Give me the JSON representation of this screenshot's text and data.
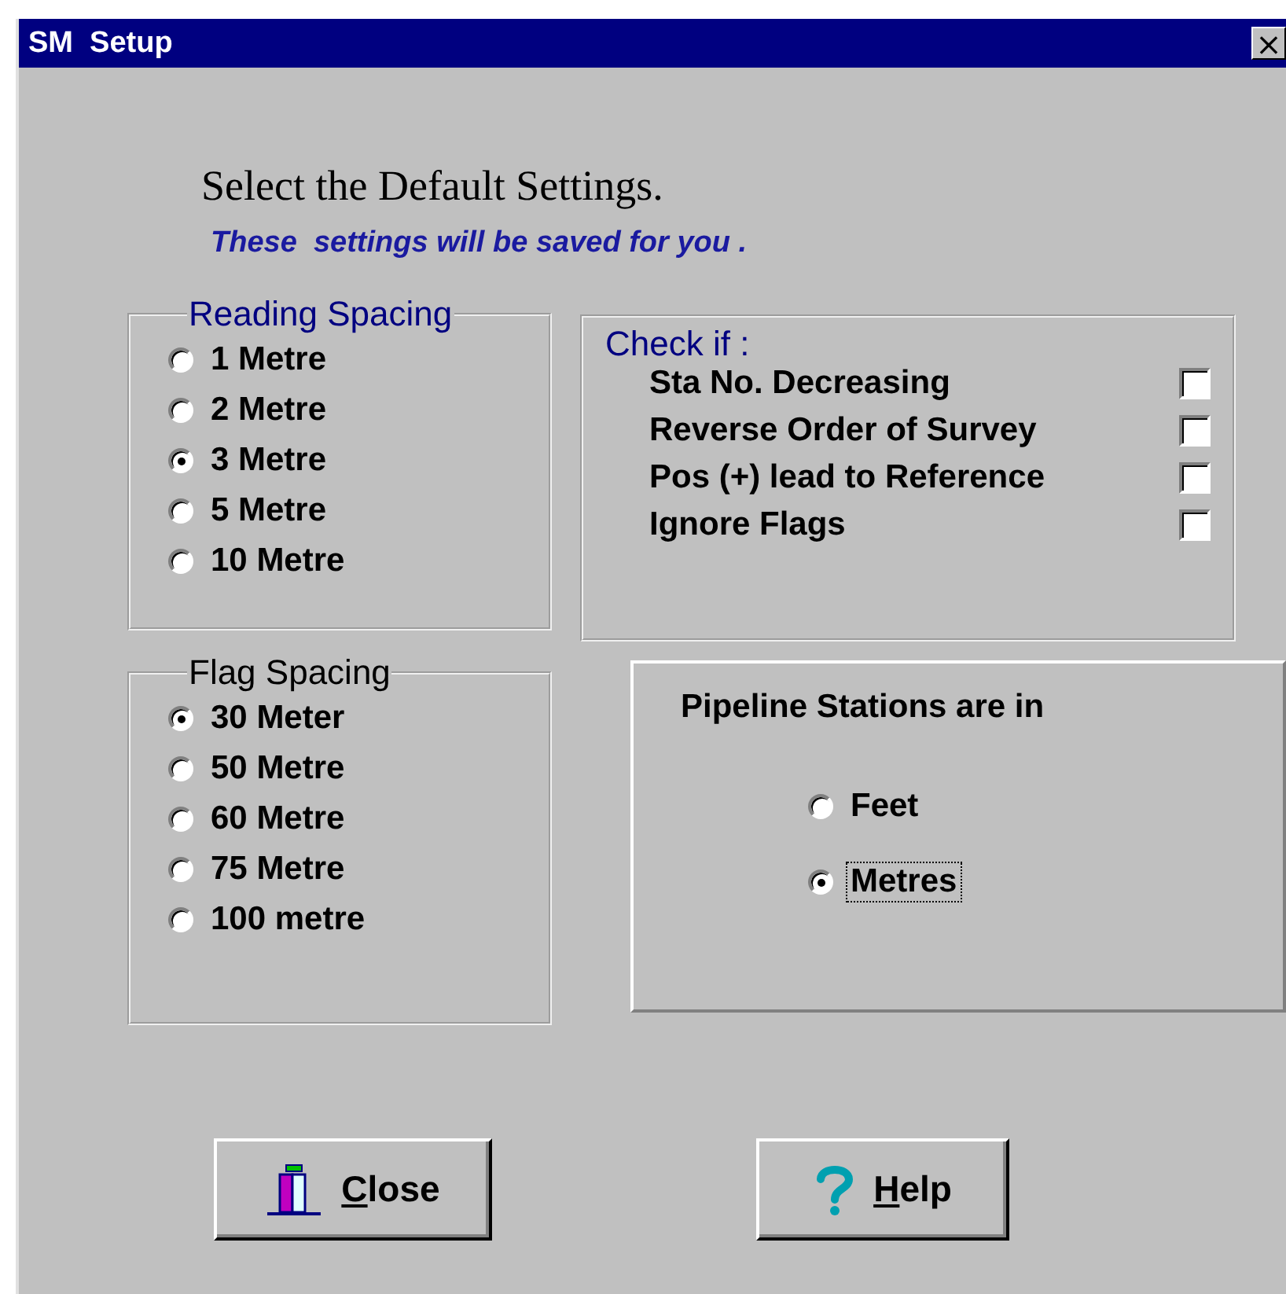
{
  "window": {
    "title": "SM  Setup",
    "close_glyph": "×"
  },
  "heading": "Select the Default Settings.",
  "subheading": "These  settings will be saved for you .",
  "reading_spacing": {
    "title": "Reading Spacing",
    "color": "#000080",
    "options": [
      {
        "label": "1 Metre",
        "selected": false
      },
      {
        "label": "2 Metre",
        "selected": false
      },
      {
        "label": "3 Metre",
        "selected": true
      },
      {
        "label": "5 Metre",
        "selected": false
      },
      {
        "label": "10 Metre",
        "selected": false
      }
    ]
  },
  "check_panel": {
    "title": "Check if :",
    "items": [
      {
        "label": "Sta No. Decreasing",
        "checked": false
      },
      {
        "label": "Reverse Order of Survey",
        "checked": false
      },
      {
        "label": "Pos (+) lead to Reference",
        "checked": false
      },
      {
        "label": "Ignore Flags",
        "checked": false
      }
    ]
  },
  "flag_spacing": {
    "title": "Flag Spacing",
    "color": "#000000",
    "options": [
      {
        "label": "30 Meter",
        "selected": true
      },
      {
        "label": "50 Metre",
        "selected": false
      },
      {
        "label": "60 Metre",
        "selected": false
      },
      {
        "label": "75 Metre",
        "selected": false
      },
      {
        "label": "100 metre",
        "selected": false
      }
    ]
  },
  "stations": {
    "title": "Pipeline Stations are in",
    "options": [
      {
        "label": "Feet",
        "selected": false,
        "focused": false
      },
      {
        "label": "Metres",
        "selected": true,
        "focused": true
      }
    ]
  },
  "buttons": [
    {
      "label": "Close",
      "kind": "close"
    },
    {
      "label": "Help",
      "kind": "help"
    }
  ]
}
